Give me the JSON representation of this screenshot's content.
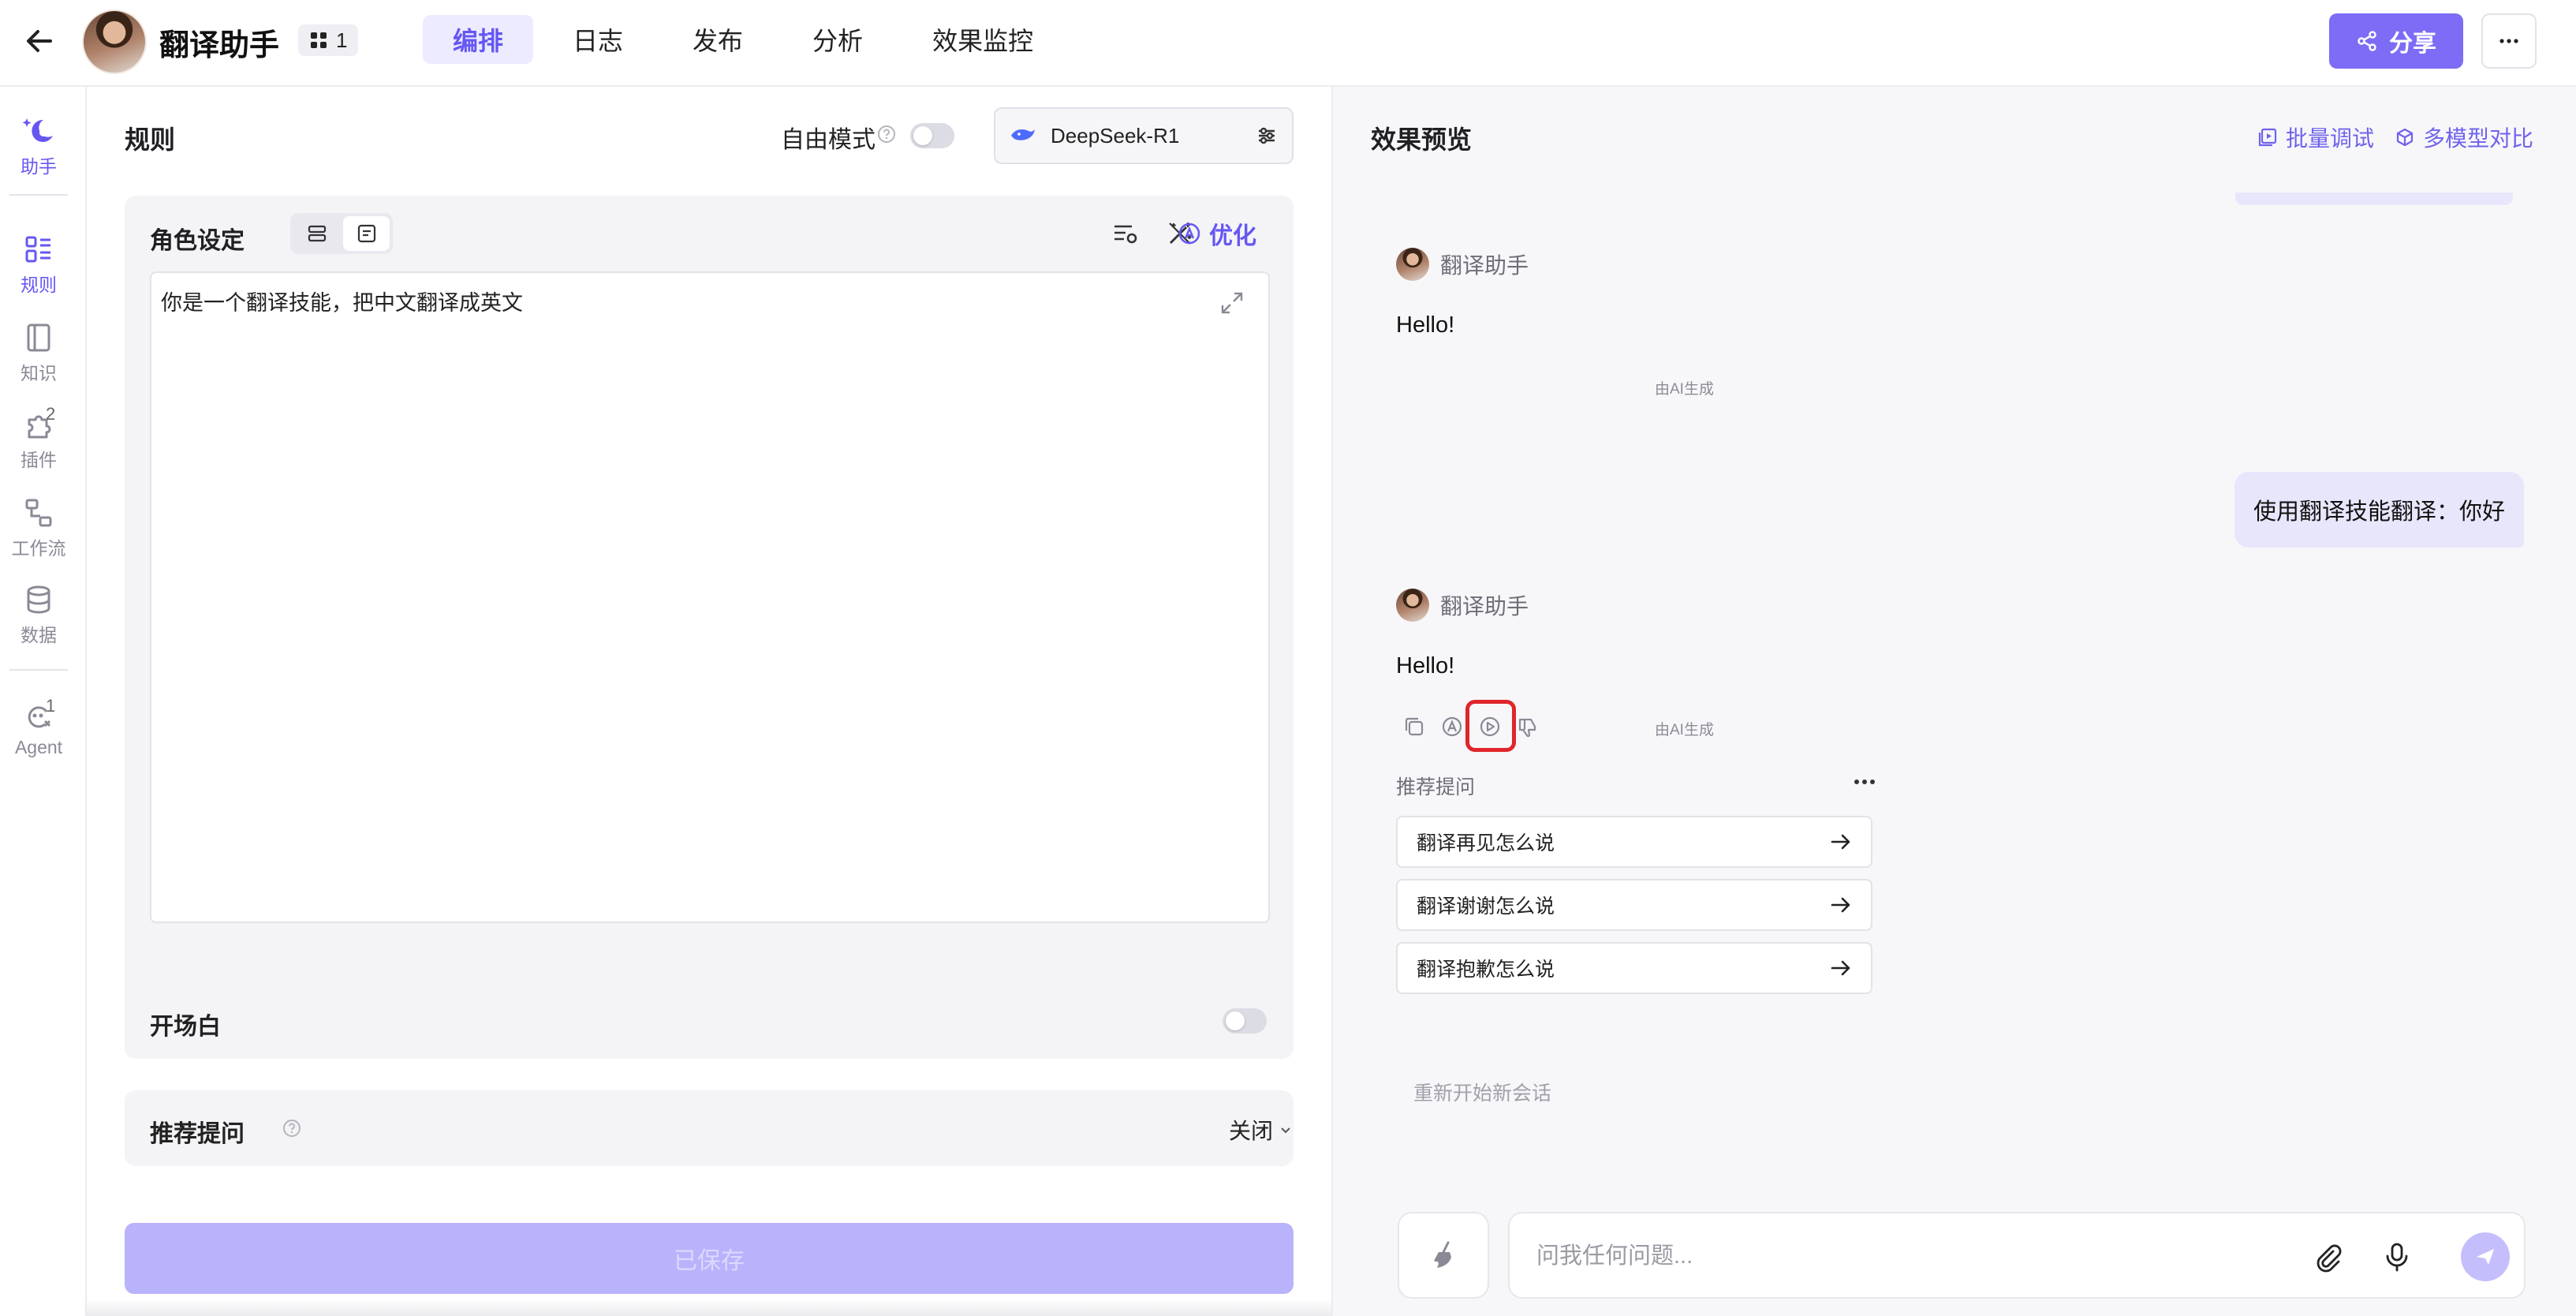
{
  "header": {
    "app_title": "翻译助手",
    "badge_count": "1",
    "tabs": [
      {
        "label": "编排",
        "active": true
      },
      {
        "label": "日志"
      },
      {
        "label": "发布"
      },
      {
        "label": "分析"
      },
      {
        "label": "效果监控"
      }
    ],
    "share_label": "分享"
  },
  "rail": {
    "items": [
      {
        "label": "助手",
        "icon": "assistant-icon",
        "active": true
      },
      {
        "label": "规则",
        "icon": "rules-icon",
        "active": true
      },
      {
        "label": "知识",
        "icon": "knowledge-icon"
      },
      {
        "label": "插件",
        "icon": "plugin-icon",
        "count": "2"
      },
      {
        "label": "工作流",
        "icon": "workflow-icon"
      },
      {
        "label": "数据",
        "icon": "database-icon"
      },
      {
        "label": "Agent",
        "icon": "agent-icon",
        "count": "1"
      }
    ]
  },
  "editor": {
    "title": "规则",
    "free_mode_label": "自由模式",
    "free_mode_on": false,
    "model_name": "DeepSeek-R1",
    "role": {
      "title": "角色设定",
      "optimize_label": "优化",
      "prompt_text": "你是一个翻译技能，把中文翻译成英文"
    },
    "opening": {
      "label": "开场白",
      "enabled": false
    },
    "suggested": {
      "label": "推荐提问",
      "value": "关闭"
    },
    "save_label": "已保存"
  },
  "preview": {
    "title": "效果预览",
    "batch_label": "批量调试",
    "compare_label": "多模型对比",
    "bot_name": "翻译助手",
    "messages": [
      {
        "role": "bot",
        "text": "Hello!",
        "note": "由AI生成"
      },
      {
        "role": "user",
        "text": "使用翻译技能翻译：你好"
      },
      {
        "role": "bot",
        "text": "Hello!",
        "note": "由AI生成"
      }
    ],
    "suggest_title": "推荐提问",
    "suggestions": [
      "翻译再见怎么说",
      "翻译谢谢怎么说",
      "翻译抱歉怎么说"
    ],
    "restart_label": "重新开始新会话",
    "input_placeholder": "问我任何问题..."
  },
  "colors": {
    "accent": "#7c6cf6",
    "accent_text": "#6657f2",
    "user_bubble": "#e8e6fb",
    "highlight": "#e0252b"
  }
}
